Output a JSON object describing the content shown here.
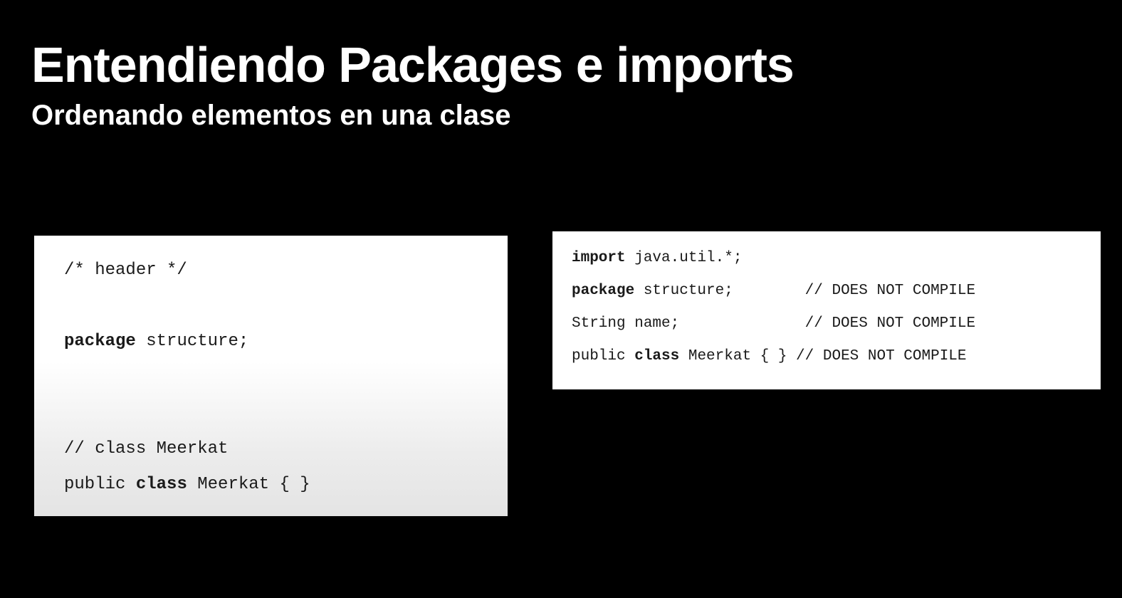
{
  "slide": {
    "title": "Entendiendo Packages e imports",
    "subtitle": "Ordenando elementos en una clase"
  },
  "left_code": {
    "line1": "/* header */",
    "line2_kw": "package",
    "line2_rest": " structure;",
    "line3": "// class Meerkat",
    "line4_pre": "public ",
    "line4_kw": "class",
    "line4_post": " Meerkat { }"
  },
  "right_code": {
    "line1_kw": "import",
    "line1_rest": " java.util.*;",
    "line2_kw": "package",
    "line2_rest": " structure;        // DOES NOT COMPILE",
    "line3": "String name;              // DOES NOT COMPILE",
    "line4_pre": "public ",
    "line4_kw": "class",
    "line4_post": " Meerkat { } // DOES NOT COMPILE"
  },
  "colors": {
    "background": "#000000",
    "heading_text": "#ffffff",
    "code_text": "#1a1a1a",
    "card_background": "#ffffff"
  }
}
